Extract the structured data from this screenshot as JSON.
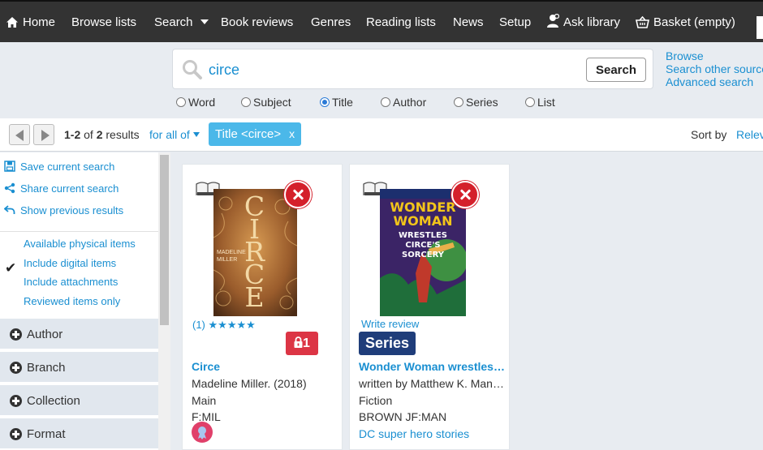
{
  "nav": {
    "home": "Home",
    "browse_lists": "Browse lists",
    "search": "Search",
    "book_reviews": "Book reviews",
    "genres": "Genres",
    "reading_lists": "Reading lists",
    "news": "News",
    "setup": "Setup",
    "ask_library": "Ask library",
    "basket": "Basket (empty)"
  },
  "search": {
    "query": "circe",
    "button_label": "Search",
    "side_links": [
      "Browse",
      "Search other sources",
      "Advanced search"
    ],
    "fields": [
      "Word",
      "Subject",
      "Title",
      "Author",
      "Series",
      "List"
    ],
    "selected_field": "Title"
  },
  "results": {
    "range": "1-2",
    "of_label": "of",
    "total": "2",
    "results_label": "results",
    "for_all_of": "for all of",
    "filter_chip": "Title <circe>",
    "chip_close": "x",
    "sort_by_label": "Sort by",
    "sort_value": "Relevance"
  },
  "sidebar": {
    "actions": [
      "Save current search",
      "Share current search",
      "Show previous results"
    ],
    "options": [
      "Available physical items",
      "Include digital items",
      "Include attachments",
      "Reviewed items only"
    ],
    "checked_option": "Include digital items",
    "check_mark": "✔",
    "facets": [
      "Author",
      "Branch",
      "Collection",
      "Format"
    ]
  },
  "cards": [
    {
      "cover_title": "CIRCE",
      "cover_author": "MADELINE MILLER",
      "rating_count": "(1)",
      "stars": "★★★★★",
      "lock_count": "1",
      "title": "Circe",
      "byline": "Madeline Miller. (2018)",
      "collection": "Main",
      "call_number": "F:MIL"
    },
    {
      "cover_title": "WONDER WOMAN",
      "cover_subtitle": "WRESTLES CIRCE'S SORCERY",
      "write_review": "Write review",
      "badge": "Series",
      "title": "Wonder Woman wrestles Circe's sorcery",
      "byline": "written by Matthew K. Manning",
      "collection": "Fiction",
      "call_number": "BROWN JF:MAN",
      "series_link": "DC super hero stories"
    }
  ],
  "colors": {
    "nav_bg": "#333333",
    "link": "#1a8fd1",
    "chip": "#4bb8e9",
    "remove": "#d4202b",
    "series_badge": "#1f3d7a"
  }
}
